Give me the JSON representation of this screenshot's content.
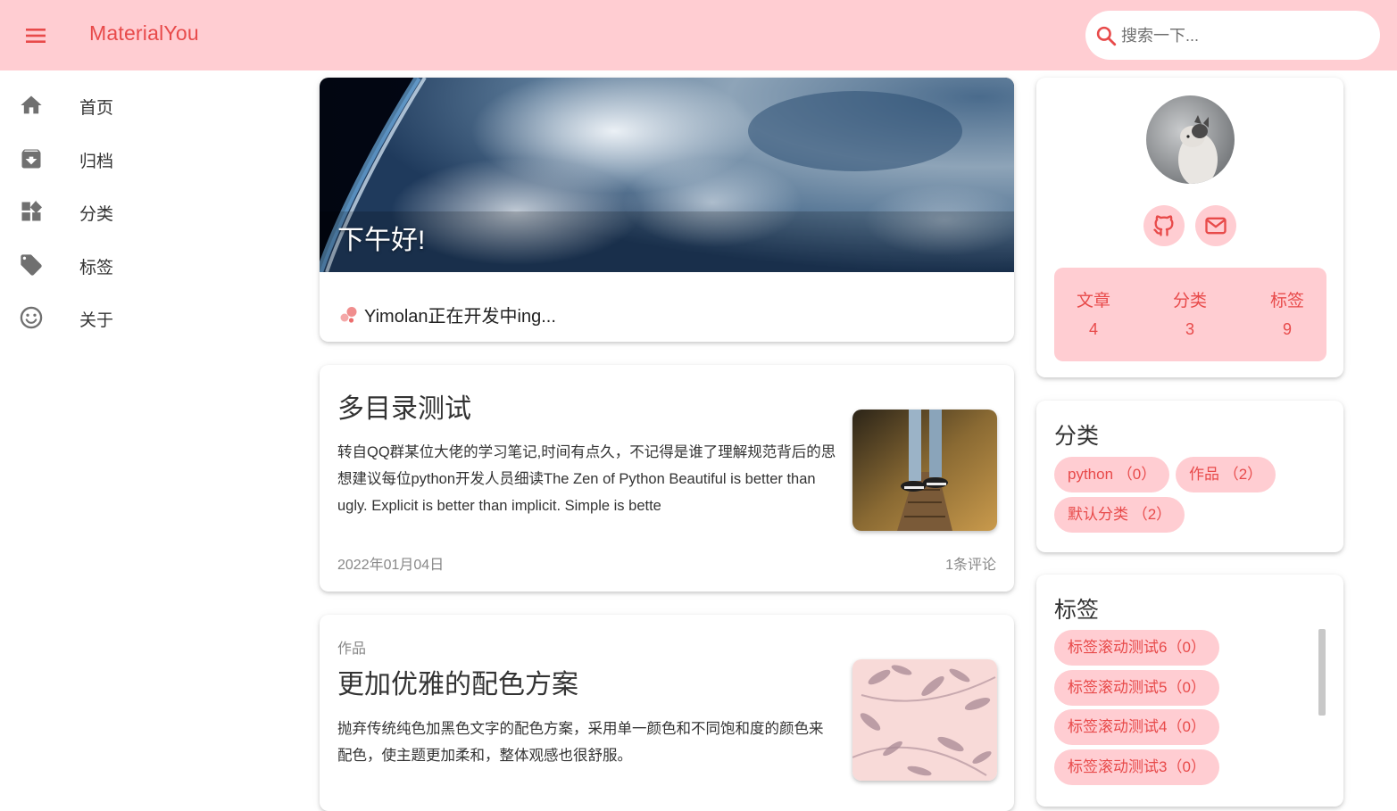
{
  "app": {
    "brand": "MaterialYou",
    "colors": {
      "accent": "#e84a4a",
      "surface_tint": "#ffcdd2"
    }
  },
  "search": {
    "placeholder": "搜索一下..."
  },
  "sidebar": {
    "items": [
      {
        "label": "首页",
        "icon": "home-icon"
      },
      {
        "label": "归档",
        "icon": "archive-icon"
      },
      {
        "label": "分类",
        "icon": "category-icon"
      },
      {
        "label": "标签",
        "icon": "tag-icon"
      },
      {
        "label": "关于",
        "icon": "smiley-icon"
      }
    ]
  },
  "hero": {
    "greeting": "下午好!",
    "notice": "Yimolan正在开发中ing..."
  },
  "posts": [
    {
      "title": "多目录测试",
      "excerpt": "转自QQ群某位大佬的学习笔记,时间有点久，不记得是谁了理解规范背后的思想建议每位python开发人员细读The Zen of Python Beautiful is better than ugly. Explicit is better than implicit. Simple is bette",
      "date": "2022年01月04日",
      "comments": "1条评论"
    },
    {
      "category": "作品",
      "title": "更加优雅的配色方案",
      "excerpt": "抛弃传统纯色加黑色文字的配色方案，采用单一颜色和不同饱和度的颜色来配色，使主题更加柔和，整体观感也很舒服。"
    }
  ],
  "profile": {
    "stats": [
      {
        "label": "文章",
        "value": "4"
      },
      {
        "label": "分类",
        "value": "3"
      },
      {
        "label": "标签",
        "value": "9"
      }
    ]
  },
  "categories": {
    "title": "分类",
    "items": [
      "python （0）",
      "作品 （2）",
      "默认分类 （2）"
    ]
  },
  "tags": {
    "title": "标签",
    "items": [
      "标签滚动测试6（0）",
      "标签滚动测试5（0）",
      "标签滚动测试4（0）",
      "标签滚动测试3（0）"
    ]
  }
}
